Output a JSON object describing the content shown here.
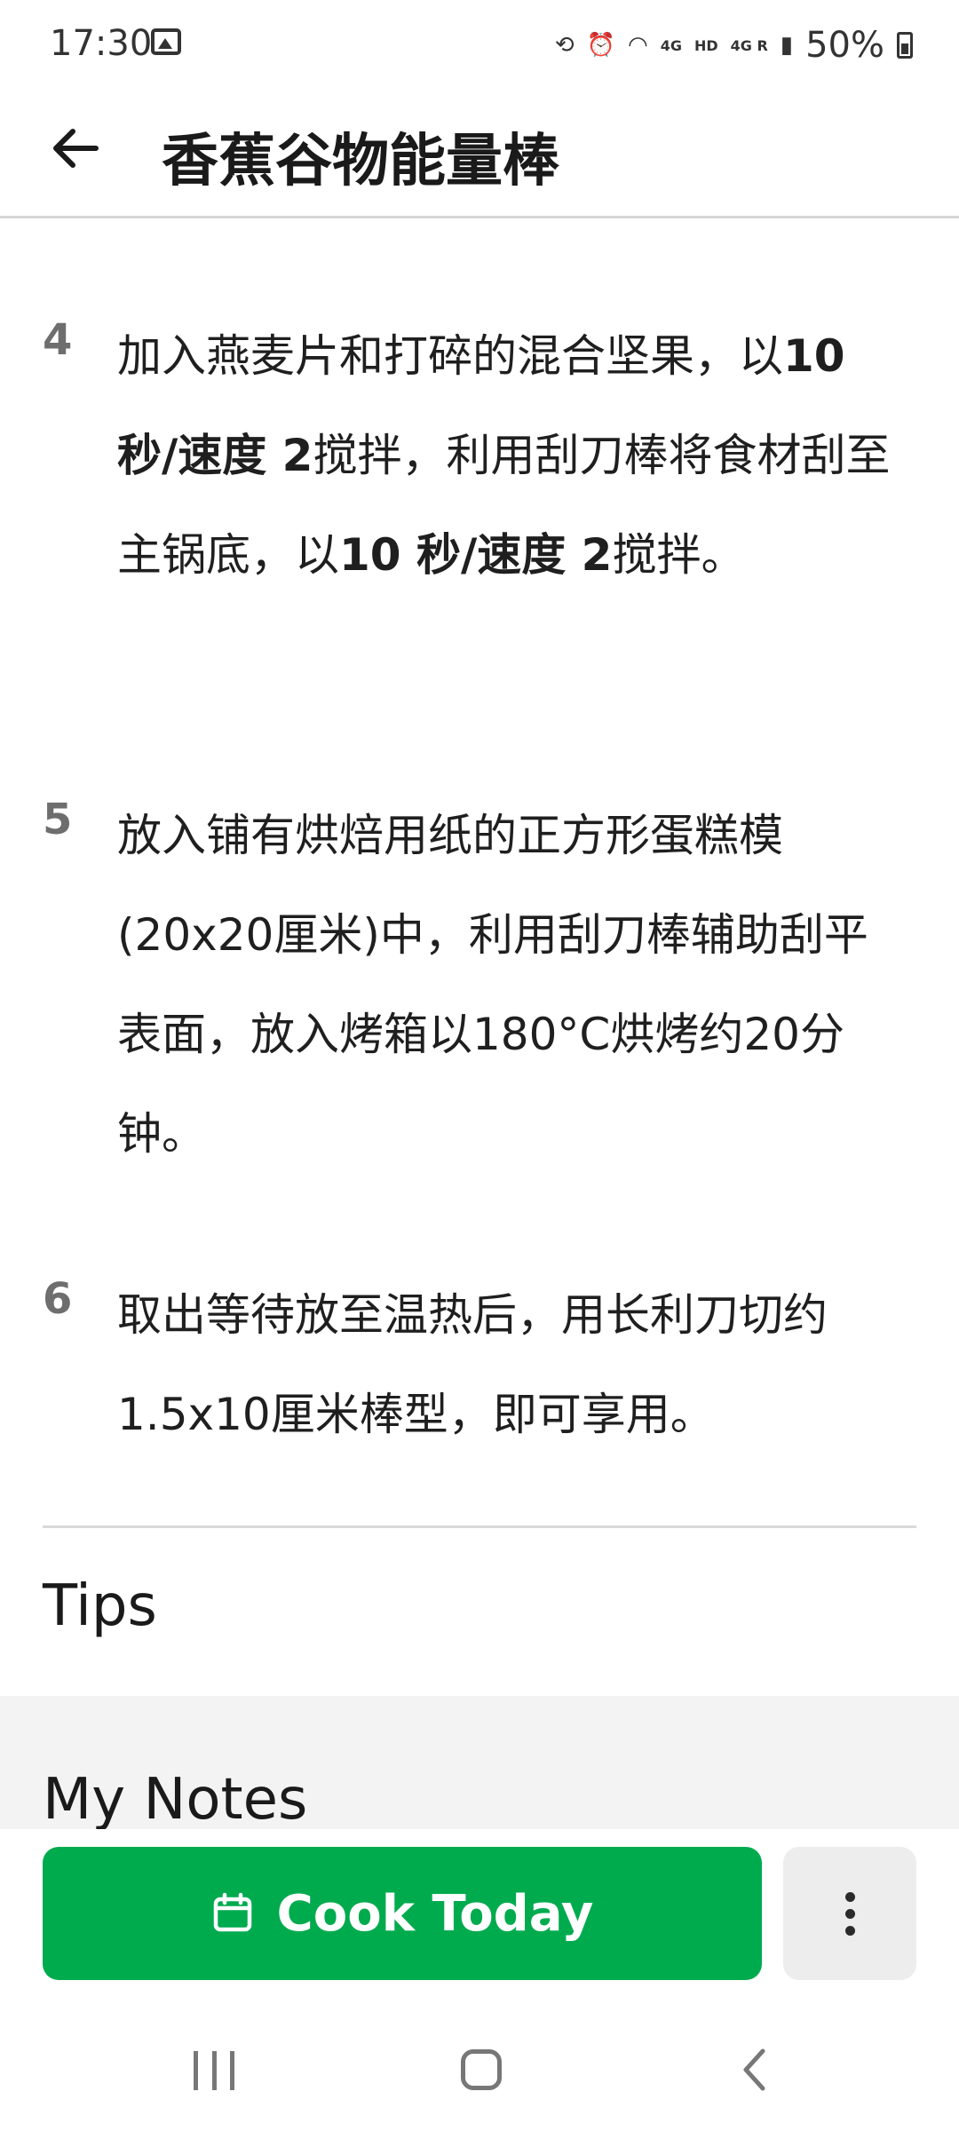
{
  "status_bar": {
    "time": "17:30",
    "network_4g_a": "4G",
    "hd": "HD",
    "network_4g_b": "4G R",
    "battery": "50%"
  },
  "app_bar": {
    "title": "香蕉谷物能量棒",
    "back_icon": "arrow-left-icon"
  },
  "steps": [
    {
      "number": "4",
      "segments": [
        {
          "text": "加入燕麦片和打碎的混合坚果，以",
          "bold": false
        },
        {
          "text": "10 秒/速度 2",
          "bold": true
        },
        {
          "text": "搅拌，利用刮刀棒将食材刮至主锅底，以",
          "bold": false
        },
        {
          "text": "10 秒/速度 2",
          "bold": true
        },
        {
          "text": "搅拌。",
          "bold": false
        }
      ]
    },
    {
      "number": "5",
      "segments": [
        {
          "text": "放入铺有烘焙用纸的正方形蛋糕模(20x20厘米)中，利用刮刀棒辅助刮平表面，放入烤箱以180°C烘烤约20分钟。",
          "bold": false
        }
      ]
    },
    {
      "number": "6",
      "segments": [
        {
          "text": "取出等待放至温热后，用长利刀切约1.5x10厘米棒型，即可享用。",
          "bold": false
        }
      ]
    }
  ],
  "sections": {
    "tips": "Tips",
    "my_notes": "My Notes"
  },
  "actions": {
    "cook_today": "Cook Today",
    "cook_icon": "calendar-icon",
    "more_icon": "more-vertical-icon"
  },
  "colors": {
    "accent_green": "#00ab4e",
    "notes_background": "#f2f3f2",
    "step_number": "#6e6e6e"
  }
}
